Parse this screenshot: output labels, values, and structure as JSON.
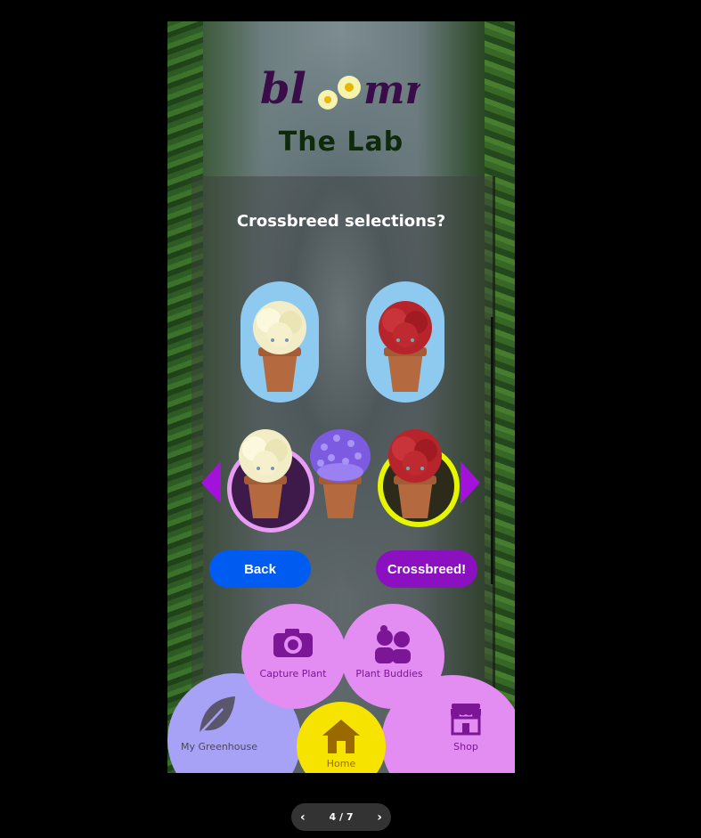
{
  "app": {
    "logo_text": "bloomr",
    "page_title": "The Lab"
  },
  "lab": {
    "question": "Crossbreed selections?",
    "selected_plants": [
      "cream-rose-icon",
      "red-rose-icon"
    ],
    "carousel": [
      "cream-rose-icon",
      "purple-hyacinth-icon",
      "red-rose-icon"
    ]
  },
  "buttons": {
    "back": "Back",
    "crossbreed": "Crossbreed!"
  },
  "nav": {
    "capture": "Capture Plant",
    "buddies": "Plant Buddies",
    "greenhouse": "My Greenhouse",
    "home": "Home",
    "shop": "Shop"
  },
  "pager": {
    "text": "4 / 7"
  },
  "colors": {
    "slot_bg": "#8ecaf0",
    "arrow": "#a212d8",
    "back_btn": "#005cf0",
    "crossbreed_btn": "#8a10c0",
    "nav_pink": "#e38cf2",
    "nav_lavender": "#a7a2f6",
    "nav_yellow": "#f6e400",
    "title": "#0f2a0a"
  }
}
